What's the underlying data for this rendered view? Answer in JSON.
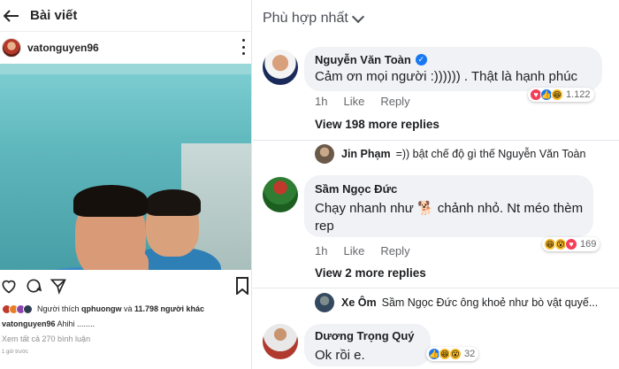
{
  "instagram": {
    "back_icon": "arrow-left-icon",
    "title": "Bài viết",
    "username": "vatonguyen96",
    "likes_prefix": "Người thích",
    "likes_user": "qphuongw",
    "likes_and": "và",
    "likes_count": "11.798 người khác",
    "caption_user": "vatonguyen96",
    "caption_text": "Ahihi ........",
    "view_all_comments": "Xem tất cả 270 bình luận",
    "time": "1 giờ trước"
  },
  "facebook": {
    "sort_label": "Phù hợp nhất",
    "comments": [
      {
        "name": "Nguyễn Văn Toàn",
        "verified": true,
        "text": "Cảm ơn mọi người :)))))) . Thật là hạnh phúc",
        "time": "1h",
        "like_label": "Like",
        "reply_label": "Reply",
        "reaction_count": "1.122",
        "view_more": "View 198 more replies",
        "reply": {
          "name": "Jin Phạm",
          "text": "=)) bật chế độ gì thế Nguyễn Văn Toàn"
        }
      },
      {
        "name": "Sầm Ngọc Đức",
        "verified": false,
        "text_line1": "Chạy nhanh như 🐕 chảnh nhỏ. Nt méo thèm",
        "text_line2": "rep",
        "time": "1h",
        "like_label": "Like",
        "reply_label": "Reply",
        "reaction_count": "169",
        "view_more": "View 2 more replies",
        "reply": {
          "name": "Xe Ôm",
          "text": "Sầm Ngọc Đức ông khoẻ như bò vật quyế..."
        }
      },
      {
        "name": "Dương Trọng Quý",
        "verified": false,
        "text": "Ok rồi e.",
        "reaction_count": "32"
      }
    ]
  },
  "colors": {
    "fb_blue": "#1877f2",
    "bubble": "#f0f2f5",
    "ig_teal": "#5fb8bd"
  }
}
